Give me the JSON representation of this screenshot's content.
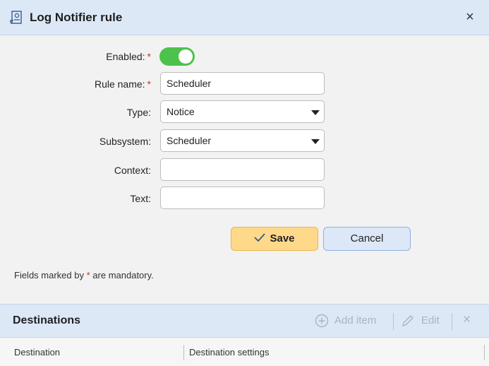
{
  "dialog": {
    "title": "Log Notifier rule",
    "icon": "scroll-gear-icon",
    "close_label": "×"
  },
  "form": {
    "enabled": {
      "label": "Enabled:",
      "required_mark": "*",
      "value": true
    },
    "rule_name": {
      "label": "Rule name:",
      "required_mark": "*",
      "value": "Scheduler"
    },
    "type": {
      "label": "Type:",
      "value": "Notice"
    },
    "subsystem": {
      "label": "Subsystem:",
      "value": "Scheduler"
    },
    "context": {
      "label": "Context:",
      "value": ""
    },
    "text": {
      "label": "Text:",
      "value": ""
    }
  },
  "buttons": {
    "save": "Save",
    "cancel": "Cancel"
  },
  "note": {
    "prefix": "Fields marked by",
    "star": "*",
    "suffix": "are mandatory."
  },
  "destinations": {
    "title": "Destinations",
    "add_item": "Add item",
    "edit": "Edit",
    "delete": "×",
    "columns": [
      "Destination",
      "Destination settings"
    ]
  },
  "colors": {
    "accent_header": "#dde8f7",
    "toggle_on": "#4cc24c",
    "save_button": "#ffd98a",
    "cancel_button": "#dce8f8",
    "required": "#c0392b"
  }
}
